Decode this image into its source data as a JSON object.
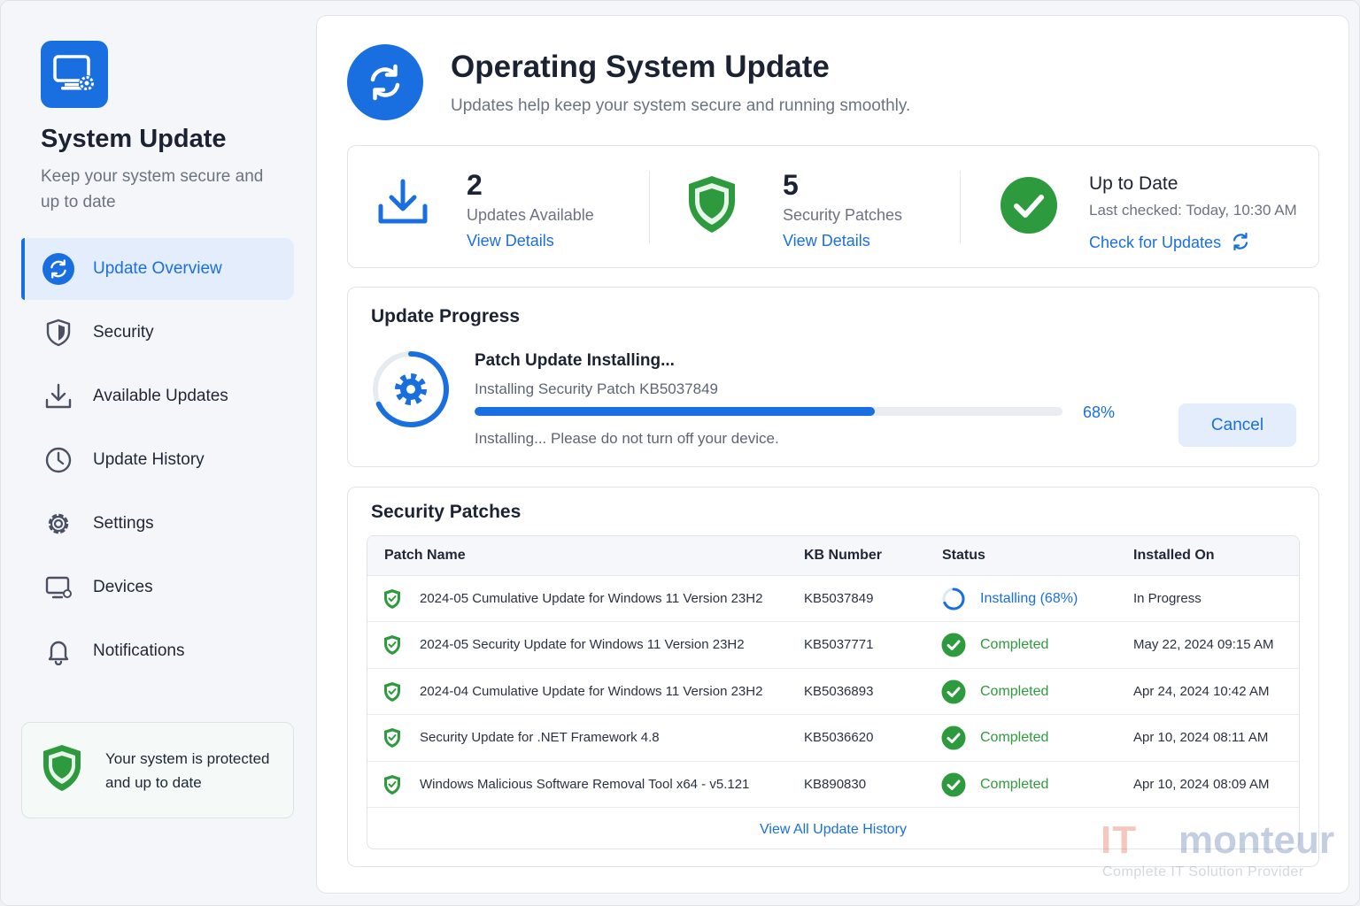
{
  "app": {
    "title": "System Update",
    "subtitle": "Keep your system secure and up to date"
  },
  "sidebar": {
    "items": [
      {
        "label": "Update Overview",
        "icon": "sync-icon",
        "active": true
      },
      {
        "label": "Security",
        "icon": "shield-icon"
      },
      {
        "label": "Available Updates",
        "icon": "download-icon"
      },
      {
        "label": "Update History",
        "icon": "clock-icon"
      },
      {
        "label": "Settings",
        "icon": "gear-icon"
      },
      {
        "label": "Devices",
        "icon": "monitor-icon"
      },
      {
        "label": "Notifications",
        "icon": "bell-icon"
      }
    ],
    "protection_text": "Your system is protected and up to date"
  },
  "header": {
    "title": "Operating System Update",
    "subtitle": "Updates help keep your system secure and running smoothly."
  },
  "stats": {
    "updates": {
      "count": "2",
      "caption": "Updates Available",
      "link": "View Details"
    },
    "patches": {
      "count": "5",
      "caption": "Security Patches",
      "link": "View Details"
    },
    "status": {
      "title": "Up to Date",
      "last_checked": "Last checked: Today, 10:30 AM",
      "link": "Check for Updates"
    }
  },
  "progress": {
    "section_title": "Update Progress",
    "title": "Patch Update Installing...",
    "subtitle": "Installing Security Patch KB5037849",
    "percent": 68,
    "percent_label": "68%",
    "note": "Installing... Please do not turn off your device.",
    "cancel_label": "Cancel"
  },
  "patches": {
    "section_title": "Security Patches",
    "columns": [
      "Patch Name",
      "KB Number",
      "Status",
      "Installed On"
    ],
    "rows": [
      {
        "name": "2024-05 Cumulative Update for Windows 11 Version 23H2",
        "kb": "KB5037849",
        "status": "Installing (68%)",
        "state": "installing",
        "installed_on": "In Progress"
      },
      {
        "name": "2024-05 Security Update for Windows 11 Version 23H2",
        "kb": "KB5037771",
        "status": "Completed",
        "state": "completed",
        "installed_on": "May 22, 2024  09:15 AM"
      },
      {
        "name": "2024-04 Cumulative Update for Windows 11 Version 23H2",
        "kb": "KB5036893",
        "status": "Completed",
        "state": "completed",
        "installed_on": "Apr 24, 2024  10:42 AM"
      },
      {
        "name": "Security Update for .NET Framework 4.8",
        "kb": "KB5036620",
        "status": "Completed",
        "state": "completed",
        "installed_on": "Apr 10, 2024  08:11 AM"
      },
      {
        "name": "Windows Malicious Software Removal Tool x64 - v5.121",
        "kb": "KB890830",
        "status": "Completed",
        "state": "completed",
        "installed_on": "Apr 10, 2024  08:09 AM"
      }
    ],
    "view_all": "View All Update History"
  },
  "watermark": {
    "brand_a": "IT",
    "brand_b": "monteur",
    "tagline": "Complete IT Solution Provider"
  },
  "colors": {
    "accent": "#1a6fe0",
    "success": "#2e9a3e",
    "active_bg": "#e3edfc"
  }
}
